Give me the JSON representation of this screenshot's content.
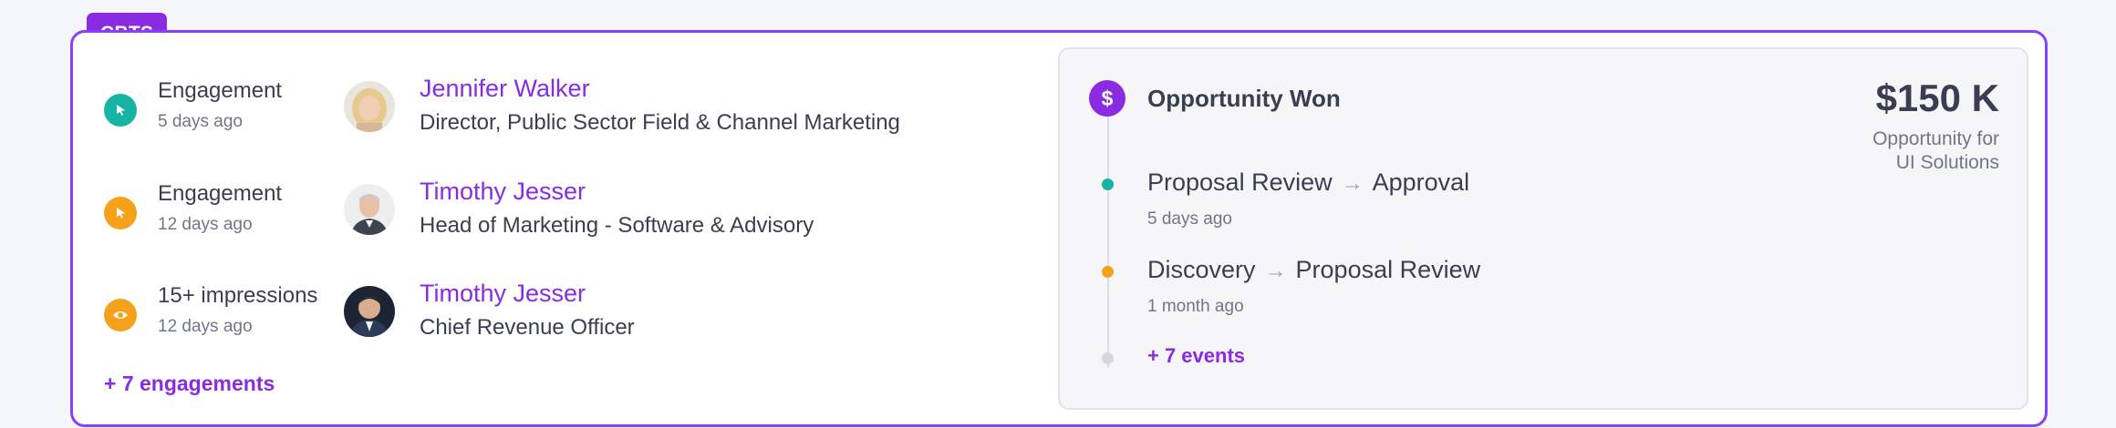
{
  "tag": "CBTS",
  "colors": {
    "accent": "#8a2be2",
    "teal": "#17b3a3",
    "orange": "#f5a11a",
    "grey_dot": "#d6d7dd"
  },
  "activities": [
    {
      "type": "Engagement",
      "time": "5 days ago",
      "icon": "cursor-click-icon",
      "icon_color": "#17b3a3",
      "person": {
        "name": "Jennifer Walker",
        "title": "Director, Public Sector Field & Channel Marketing"
      }
    },
    {
      "type": "Engagement",
      "time": "12 days ago",
      "icon": "cursor-click-icon",
      "icon_color": "#f5a11a",
      "person": {
        "name": "Timothy Jesser",
        "title": "Head of Marketing - Software & Advisory"
      }
    },
    {
      "type": "15+ impressions",
      "time": "12 days ago",
      "icon": "eye-icon",
      "icon_color": "#f5a11a",
      "person": {
        "name": "Timothy Jesser",
        "title": "Chief Revenue Officer"
      }
    }
  ],
  "more_engagements": "+ 7 engagements",
  "opportunity": {
    "badge": "$",
    "title": "Opportunity Won",
    "amount": "$150 K",
    "amount_label_line1": "Opportunity for",
    "amount_label_line2": "UI Solutions",
    "stages": [
      {
        "from": "Proposal Review",
        "arrow": "→",
        "to": "Approval",
        "time": "5 days ago",
        "dot_color": "#17b3a3"
      },
      {
        "from": "Discovery",
        "arrow": "→",
        "to": "Proposal Review",
        "time": "1 month ago",
        "dot_color": "#f5a11a"
      }
    ],
    "more_events": "+ 7 events"
  }
}
